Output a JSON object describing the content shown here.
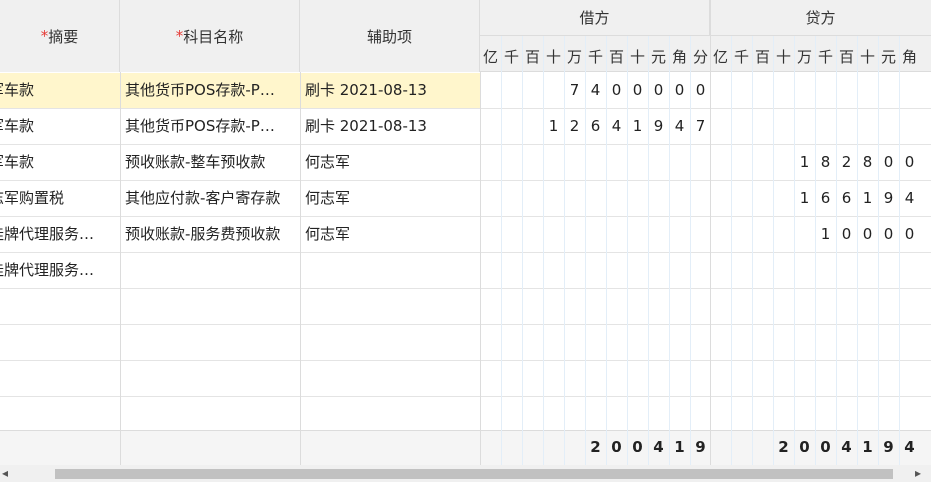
{
  "columns": {
    "summary": "摘要",
    "account": "科目名称",
    "aux": "辅助项",
    "debit": "借方",
    "credit": "贷方",
    "required_mark": "*",
    "debit_units": [
      "亿",
      "千",
      "百",
      "十",
      "万",
      "千",
      "百",
      "十",
      "元",
      "角",
      "分"
    ],
    "credit_units": [
      "亿",
      "千",
      "百",
      "十",
      "万",
      "千",
      "百",
      "十",
      "元",
      "角"
    ]
  },
  "rows": [
    {
      "summary": "军车款",
      "account": "其他货币POS存款-P…",
      "aux": "刷卡 2021-08-13",
      "debit": "7400000",
      "credit": ""
    },
    {
      "summary": "军车款",
      "account": "其他货币POS存款-P…",
      "aux": "刷卡 2021-08-13",
      "debit": "126419 47",
      "credit": ""
    },
    {
      "summary": "军车款",
      "account": "预收账款-整车预收款",
      "aux": "何志军",
      "debit": "",
      "credit": "182800"
    },
    {
      "summary": "志军购置税",
      "account": "其他应付款-客户寄存款",
      "aux": "何志军",
      "debit": "",
      "credit": "16619 4"
    },
    {
      "summary": "挂牌代理服务…",
      "account": "预收账款-服务费预收款",
      "aux": "何志军",
      "debit": "",
      "credit": "10000"
    },
    {
      "summary": "挂牌代理服务…",
      "account": "",
      "aux": "",
      "debit": "",
      "credit": ""
    }
  ],
  "totals": {
    "debit": "200419",
    "credit": "2004194"
  },
  "scroll": {
    "left_arrow": "◂",
    "right_arrow": "▸"
  }
}
